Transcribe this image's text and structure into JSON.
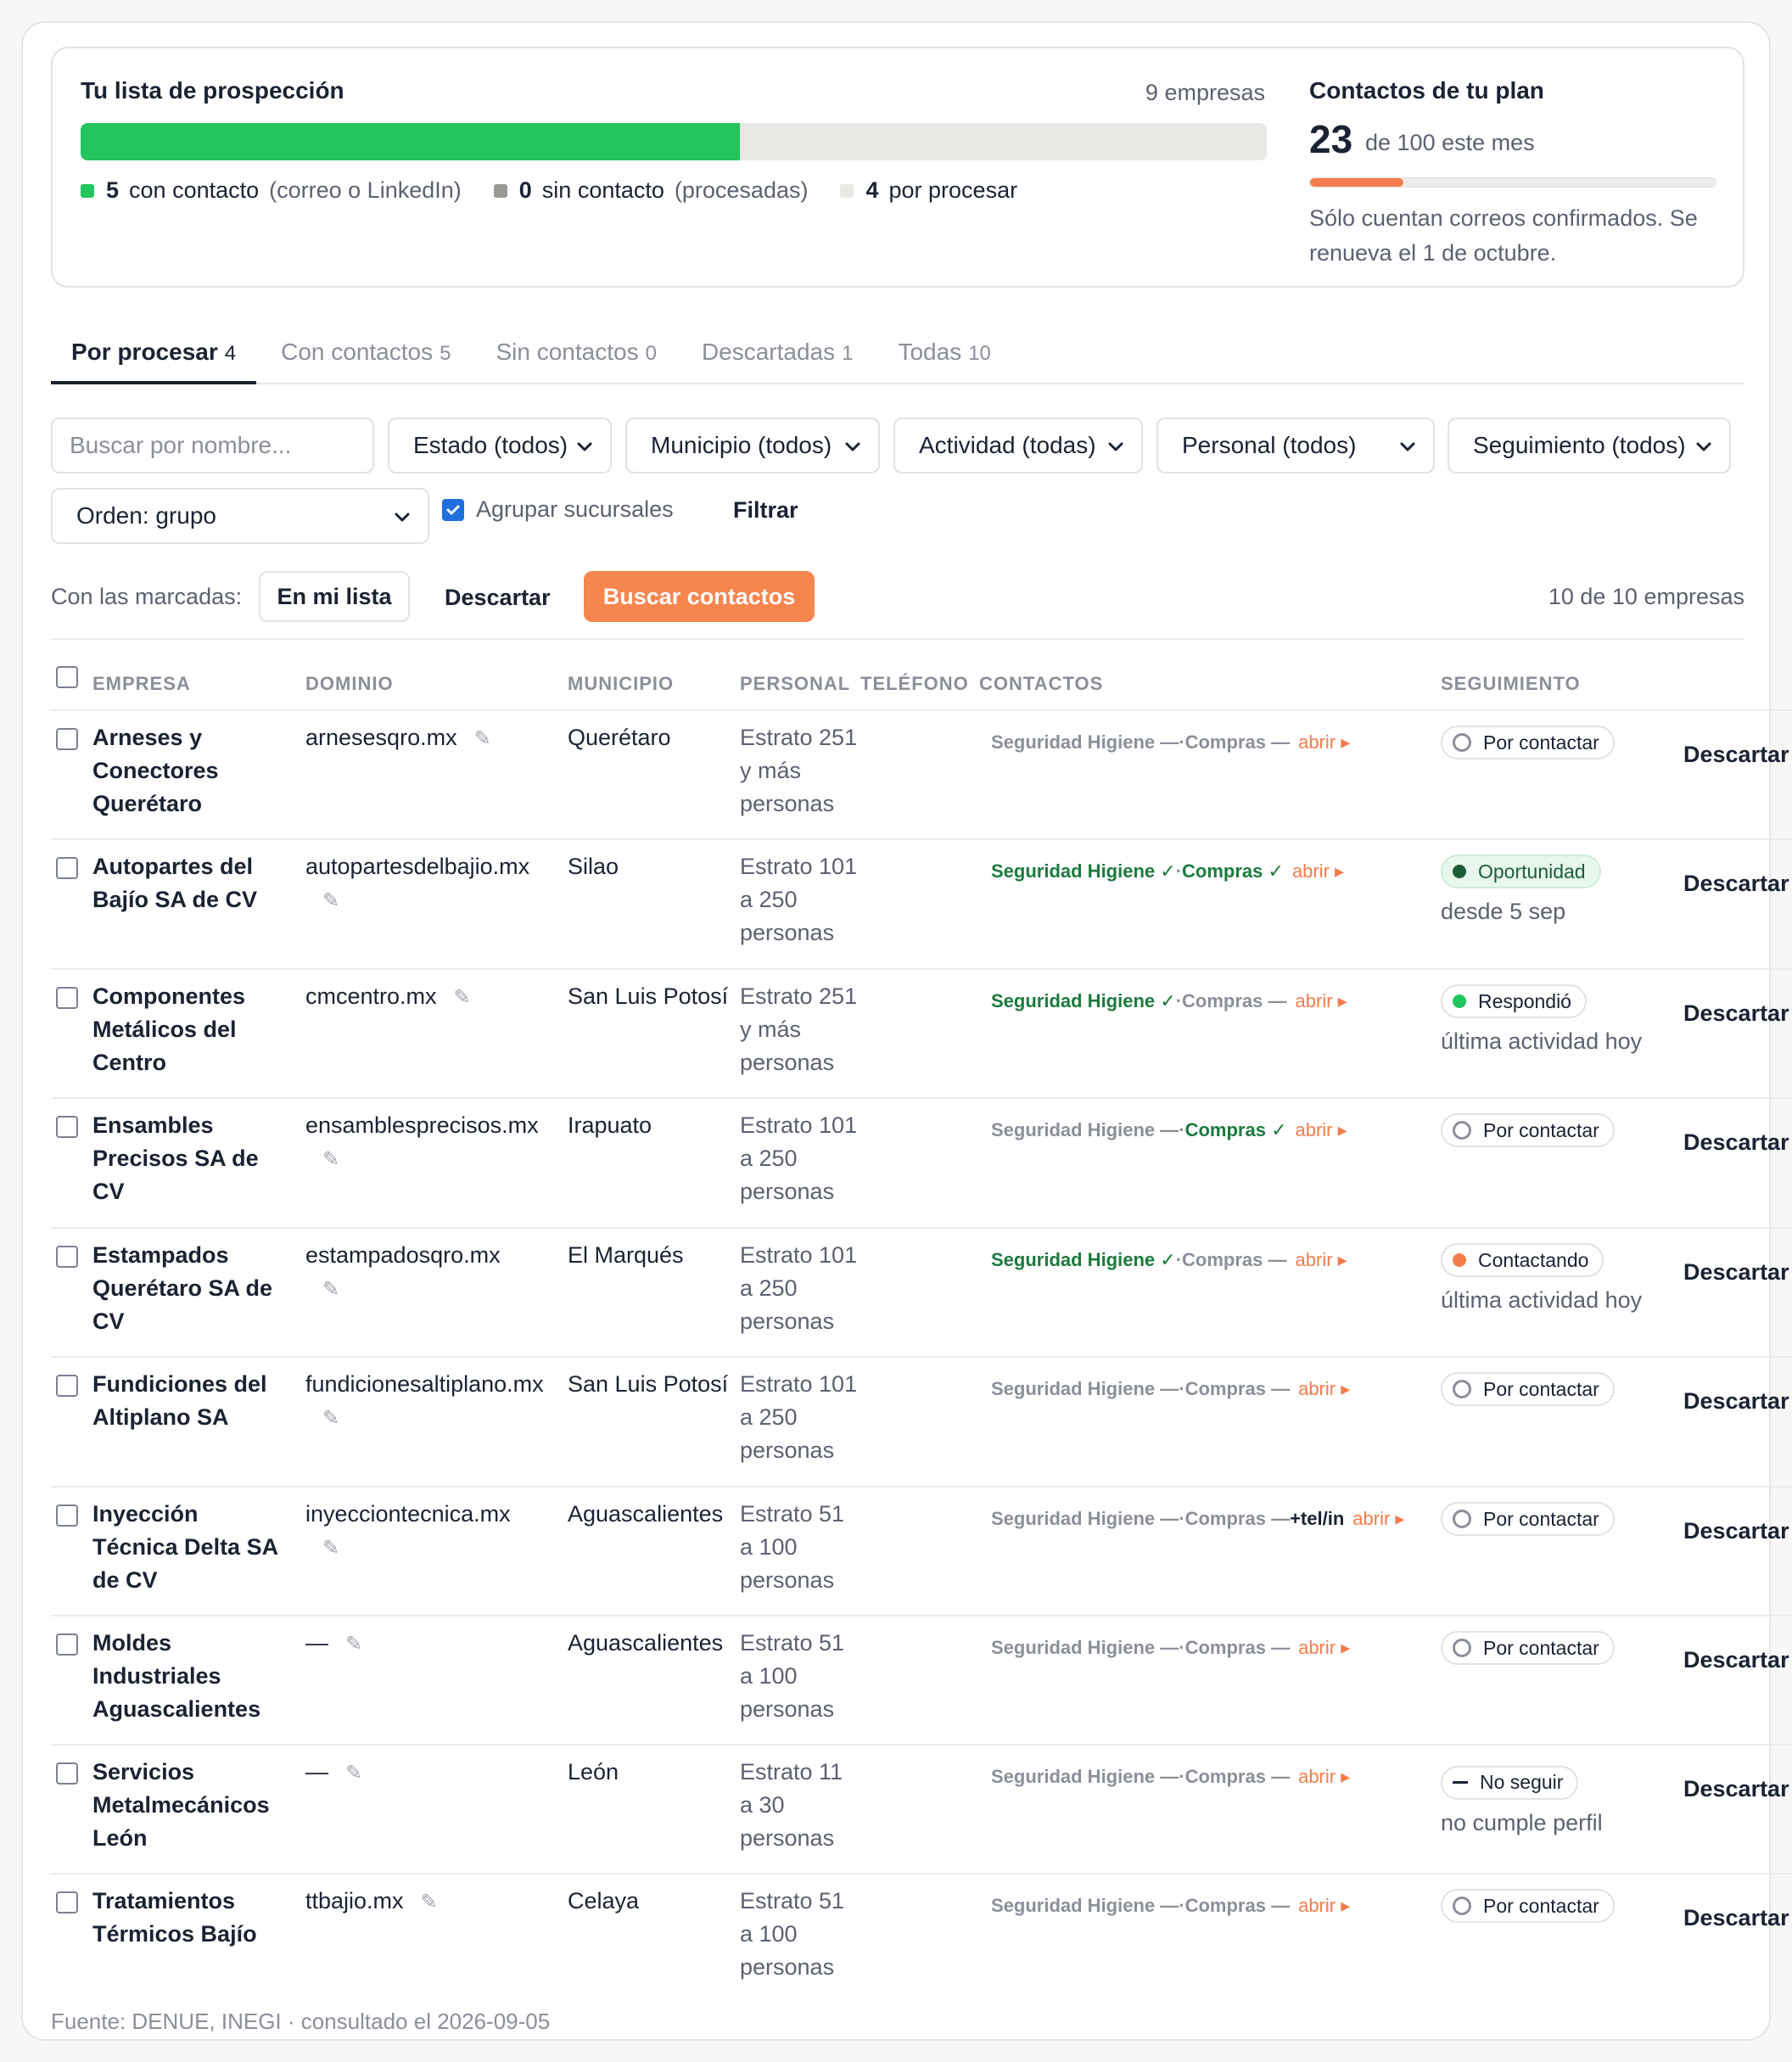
{
  "summary": {
    "title": "Tu lista de prospección",
    "count": "9 empresas",
    "progress_fraction": 0.556,
    "legend": [
      {
        "num": "5",
        "label": "con contacto",
        "note": "(correo o LinkedIn)",
        "color": "#22c55e"
      },
      {
        "num": "0",
        "label": "sin contacto",
        "note": "(procesadas)",
        "color": "#9a9a94"
      },
      {
        "num": "4",
        "label": "por procesar",
        "note": "",
        "color": "#e8e8e4"
      }
    ]
  },
  "plan": {
    "title": "Contactos de tu plan",
    "used": "23",
    "of": "de 100 este mes",
    "used_fraction": 0.23,
    "note": "Sólo cuentan correos confirmados. Se renueva el 1 de octubre."
  },
  "tabs": [
    {
      "label": "Por procesar",
      "count": "4",
      "active": true
    },
    {
      "label": "Con contactos",
      "count": "5"
    },
    {
      "label": "Sin contactos",
      "count": "0"
    },
    {
      "label": "Descartadas",
      "count": "1"
    },
    {
      "label": "Todas",
      "count": "10"
    }
  ],
  "filters": {
    "search_placeholder": "Buscar por nombre...",
    "estado": "Estado (todos)",
    "municipio": "Municipio (todos)",
    "actividad": "Actividad (todas)",
    "personal": "Personal (todos)",
    "seguimiento": "Seguimiento (todos)",
    "orden": "Orden: grupo",
    "agrupar_label": "Agrupar sucursales",
    "agrupar_checked": true,
    "filtrar": "Filtrar"
  },
  "actions": {
    "label": "Con las marcadas:",
    "en_mi_lista": "En mi lista",
    "descartar": "Descartar",
    "buscar": "Buscar contactos",
    "count": "10 de 10 empresas"
  },
  "columns": {
    "empresa": "EMPRESA",
    "dominio": "DOMINIO",
    "municipio": "MUNICIPIO",
    "personal": "PERSONAL",
    "telefono": "TELÉFONO",
    "contactos": "CONTACTOS",
    "seguimiento": "SEGUIMIENTO"
  },
  "rows": [
    {
      "empresa": "Arneses y Conectores Querétaro",
      "dominio": "arnesesqro.mx",
      "dom_wrap": false,
      "municipio": "Querétaro",
      "personal": "Estrato 251 y más personas",
      "c1": "Seguridad Higiene —",
      "c1ok": false,
      "c2": "Compras —",
      "c2ok": false,
      "extra": "",
      "abrir": "abrir ▸",
      "seg": "Por contactar",
      "seg_type": "ring",
      "seg_sub": "",
      "descartar": "Descartar"
    },
    {
      "empresa": "Autopartes del Bajío SA de CV",
      "dominio": "autopartesdelbajio.mx",
      "dom_wrap": true,
      "municipio": "Silao",
      "personal": "Estrato 101 a 250 personas",
      "c1": "Seguridad Higiene ✓",
      "c1ok": true,
      "c2": "Compras ✓",
      "c2ok": true,
      "extra": "",
      "abrir": "abrir ▸",
      "seg": "Oportunidad",
      "seg_type": "green",
      "seg_sub": "desde 5 sep",
      "descartar": "Descartar"
    },
    {
      "empresa": "Componentes Metálicos del Centro",
      "dominio": "cmcentro.mx",
      "dom_wrap": false,
      "municipio": "San Luis Potosí",
      "personal": "Estrato 251 y más personas",
      "c1": "Seguridad Higiene ✓",
      "c1ok": true,
      "c2": "Compras —",
      "c2ok": false,
      "extra": "",
      "abrir": "abrir ▸",
      "seg": "Respondió",
      "seg_type": "dot-green",
      "seg_sub": "última actividad hoy",
      "descartar": "Descartar"
    },
    {
      "empresa": "Ensambles Precisos SA de CV",
      "dominio": "ensamblesprecisos.mx",
      "dom_wrap": true,
      "municipio": "Irapuato",
      "personal": "Estrato 101 a 250 personas",
      "c1": "Seguridad Higiene —",
      "c1ok": false,
      "c2": "Compras ✓",
      "c2ok": true,
      "extra": "",
      "abrir": "abrir ▸",
      "seg": "Por contactar",
      "seg_type": "ring",
      "seg_sub": "",
      "descartar": "Descartar"
    },
    {
      "empresa": "Estampados Querétaro SA de CV",
      "dominio": "estampadosqro.mx",
      "dom_wrap": true,
      "municipio": "El Marqués",
      "personal": "Estrato 101 a 250 personas",
      "c1": "Seguridad Higiene ✓",
      "c1ok": true,
      "c2": "Compras —",
      "c2ok": false,
      "extra": "",
      "abrir": "abrir ▸",
      "seg": "Contactando",
      "seg_type": "dot-orange",
      "seg_sub": "última actividad hoy",
      "descartar": "Descartar"
    },
    {
      "empresa": "Fundiciones del Altiplano SA",
      "dominio": "fundicionesaltiplano.mx",
      "dom_wrap": true,
      "municipio": "San Luis Potosí",
      "personal": "Estrato 101 a 250 personas",
      "c1": "Seguridad Higiene —",
      "c1ok": false,
      "c2": "Compras —",
      "c2ok": false,
      "extra": "",
      "abrir": "abrir ▸",
      "seg": "Por contactar",
      "seg_type": "ring",
      "seg_sub": "",
      "descartar": "Descartar"
    },
    {
      "empresa": "Inyección Técnica Delta SA de CV",
      "dominio": "inyecciontecnica.mx",
      "dom_wrap": true,
      "municipio": "Aguascalientes",
      "personal": "Estrato 51 a 100 personas",
      "c1": "Seguridad Higiene —",
      "c1ok": false,
      "c2": "Compras —",
      "c2ok": false,
      "extra": "+tel/in",
      "abrir": "abrir ▸",
      "seg": "Por contactar",
      "seg_type": "ring",
      "seg_sub": "",
      "descartar": "Descartar"
    },
    {
      "empresa": "Moldes Industriales Aguascalientes",
      "dominio": "—",
      "dom_wrap": false,
      "municipio": "Aguascalientes",
      "personal": "Estrato 51 a 100 personas",
      "c1": "Seguridad Higiene —",
      "c1ok": false,
      "c2": "Compras —",
      "c2ok": false,
      "extra": "",
      "abrir": "abrir ▸",
      "seg": "Por contactar",
      "seg_type": "ring",
      "seg_sub": "",
      "descartar": "Descartar"
    },
    {
      "empresa": "Servicios Metalmecánicos León",
      "dominio": "—",
      "dom_wrap": false,
      "municipio": "León",
      "personal": "Estrato 11 a 30 personas",
      "c1": "Seguridad Higiene —",
      "c1ok": false,
      "c2": "Compras —",
      "c2ok": false,
      "extra": "",
      "abrir": "abrir ▸",
      "seg": "No seguir",
      "seg_type": "dash",
      "seg_sub": "no cumple perfil",
      "descartar": "Descartar"
    },
    {
      "empresa": "Tratamientos Térmicos Bajío",
      "dominio": "ttbajio.mx",
      "dom_wrap": false,
      "municipio": "Celaya",
      "personal": "Estrato 51 a 100 personas",
      "c1": "Seguridad Higiene —",
      "c1ok": false,
      "c2": "Compras —",
      "c2ok": false,
      "extra": "",
      "abrir": "abrir ▸",
      "seg": "Por contactar",
      "seg_type": "ring",
      "seg_sub": "",
      "descartar": "Descartar"
    }
  ],
  "footer": "Fuente: DENUE, INEGI · consultado el 2026-09-05"
}
